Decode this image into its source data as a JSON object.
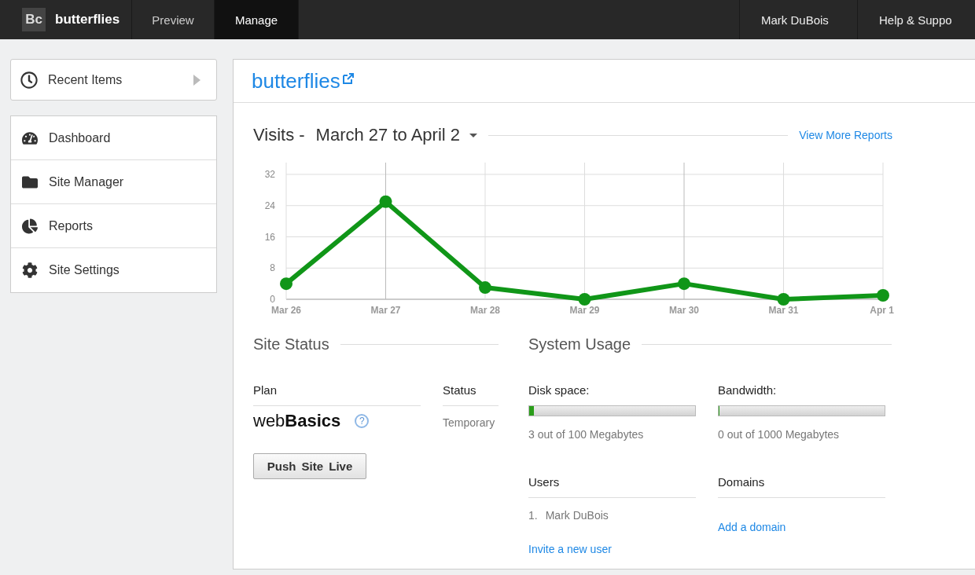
{
  "top_nav": {
    "brand": {
      "logo": "Bc",
      "name": "butterflies"
    },
    "tabs": [
      {
        "label": "Preview",
        "selected": false
      },
      {
        "label": "Manage",
        "selected": true
      }
    ],
    "right_items": [
      "Mark DuBois",
      "Help & Suppo"
    ]
  },
  "sidebar": {
    "recent": "Recent Items",
    "items": [
      {
        "label": "Dashboard"
      },
      {
        "label": "Site Manager"
      },
      {
        "label": "Reports"
      },
      {
        "label": "Site Settings"
      }
    ]
  },
  "main": {
    "site_title": "butterflies",
    "visits": {
      "range": "March 27 to April 2",
      "more_link": "View More Reports",
      "chart_data": {
        "type": "line",
        "title": "Visits -",
        "grid": true,
        "categories": [
          "Mar 26",
          "Mar 27",
          "Mar 28",
          "Mar 29",
          "Mar 30",
          "Mar 31",
          "Apr 1"
        ],
        "series": [
          {
            "color": "#109618",
            "marker": "circle",
            "values": [
              4,
              25,
              3,
              0,
              4,
              0,
              1
            ]
          }
        ],
        "ylim": [
          0,
          32
        ],
        "yticks": [
          0,
          8,
          16,
          24,
          32
        ]
      }
    },
    "site_status": {
      "title": "Site Status",
      "plan_label": "Plan",
      "plan_value": "web**Basics**",
      "help_icon": "?",
      "status_label": "Status",
      "status_value": "Temporary",
      "button": "Push Site Live"
    },
    "system_usage": {
      "title": "System Usage",
      "meters": [
        {
          "label": "Disk space:",
          "level": 0.03,
          "reading": "3 out of 100 Megabytes"
        },
        {
          "label": "Bandwidth:",
          "level": 0,
          "reading": "0 out of 1000 Megabytes"
        }
      ],
      "users": {
        "label": "Users",
        "list": [
          {
            "number": "1.",
            "name": "Mark DuBois"
          }
        ],
        "link": "Invite a new user"
      },
      "domains": {
        "label": "Domains",
        "link": "Add a domain"
      }
    }
  }
}
